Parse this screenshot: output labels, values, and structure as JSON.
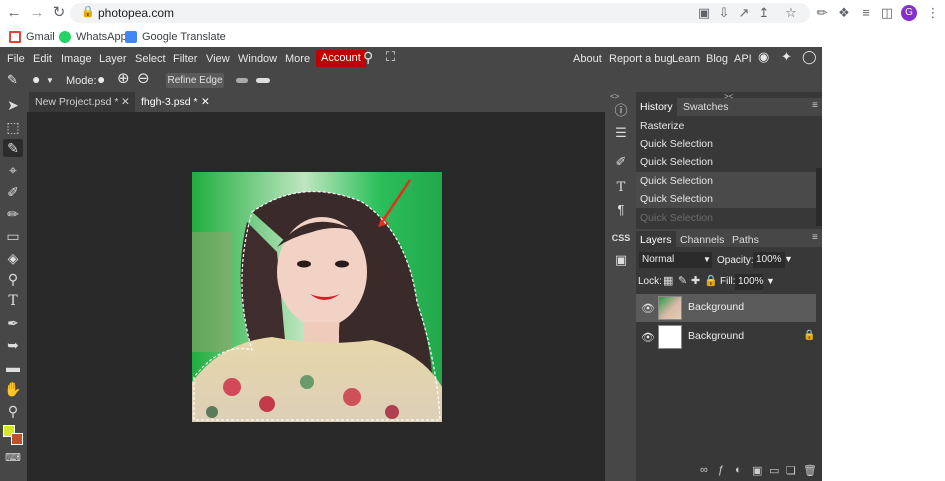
{
  "browser": {
    "url": "photopea.com",
    "bookmarks": [
      "Gmail",
      "WhatsApp",
      "Google Translate"
    ],
    "avatar_letter": "G",
    "avatar_color": "#8430ce"
  },
  "menu": {
    "items": [
      "File",
      "Edit",
      "Image",
      "Layer",
      "Select",
      "Filter",
      "View",
      "Window",
      "More"
    ],
    "account": "Account",
    "right_links": [
      "About",
      "Report a bug",
      "Learn",
      "Blog",
      "API"
    ]
  },
  "options": {
    "mode_label": "Mode:",
    "refine_edge": "Refine Edge"
  },
  "tabs": [
    {
      "label": "New Project.psd *"
    },
    {
      "label": "fhgh-3.psd *"
    }
  ],
  "history_panel": {
    "tabs": [
      "History",
      "Swatches"
    ],
    "items": [
      "Rasterize",
      "Quick Selection",
      "Quick Selection",
      "Quick Selection",
      "Quick Selection",
      "Quick Selection"
    ]
  },
  "layers_panel": {
    "tabs": [
      "Layers",
      "Channels",
      "Paths"
    ],
    "blend_mode": "Normal",
    "opacity_label": "Opacity:",
    "opacity_value": "100%",
    "lock_label": "Lock:",
    "fill_label": "Fill:",
    "fill_value": "100%",
    "layers": [
      {
        "name": "Background"
      },
      {
        "name": "Background"
      }
    ]
  },
  "panel_icons": {
    "css": "CSS"
  },
  "colors": {
    "foreground": "#d4e62a",
    "background": "#c0502a",
    "account_red": "#c00000"
  }
}
